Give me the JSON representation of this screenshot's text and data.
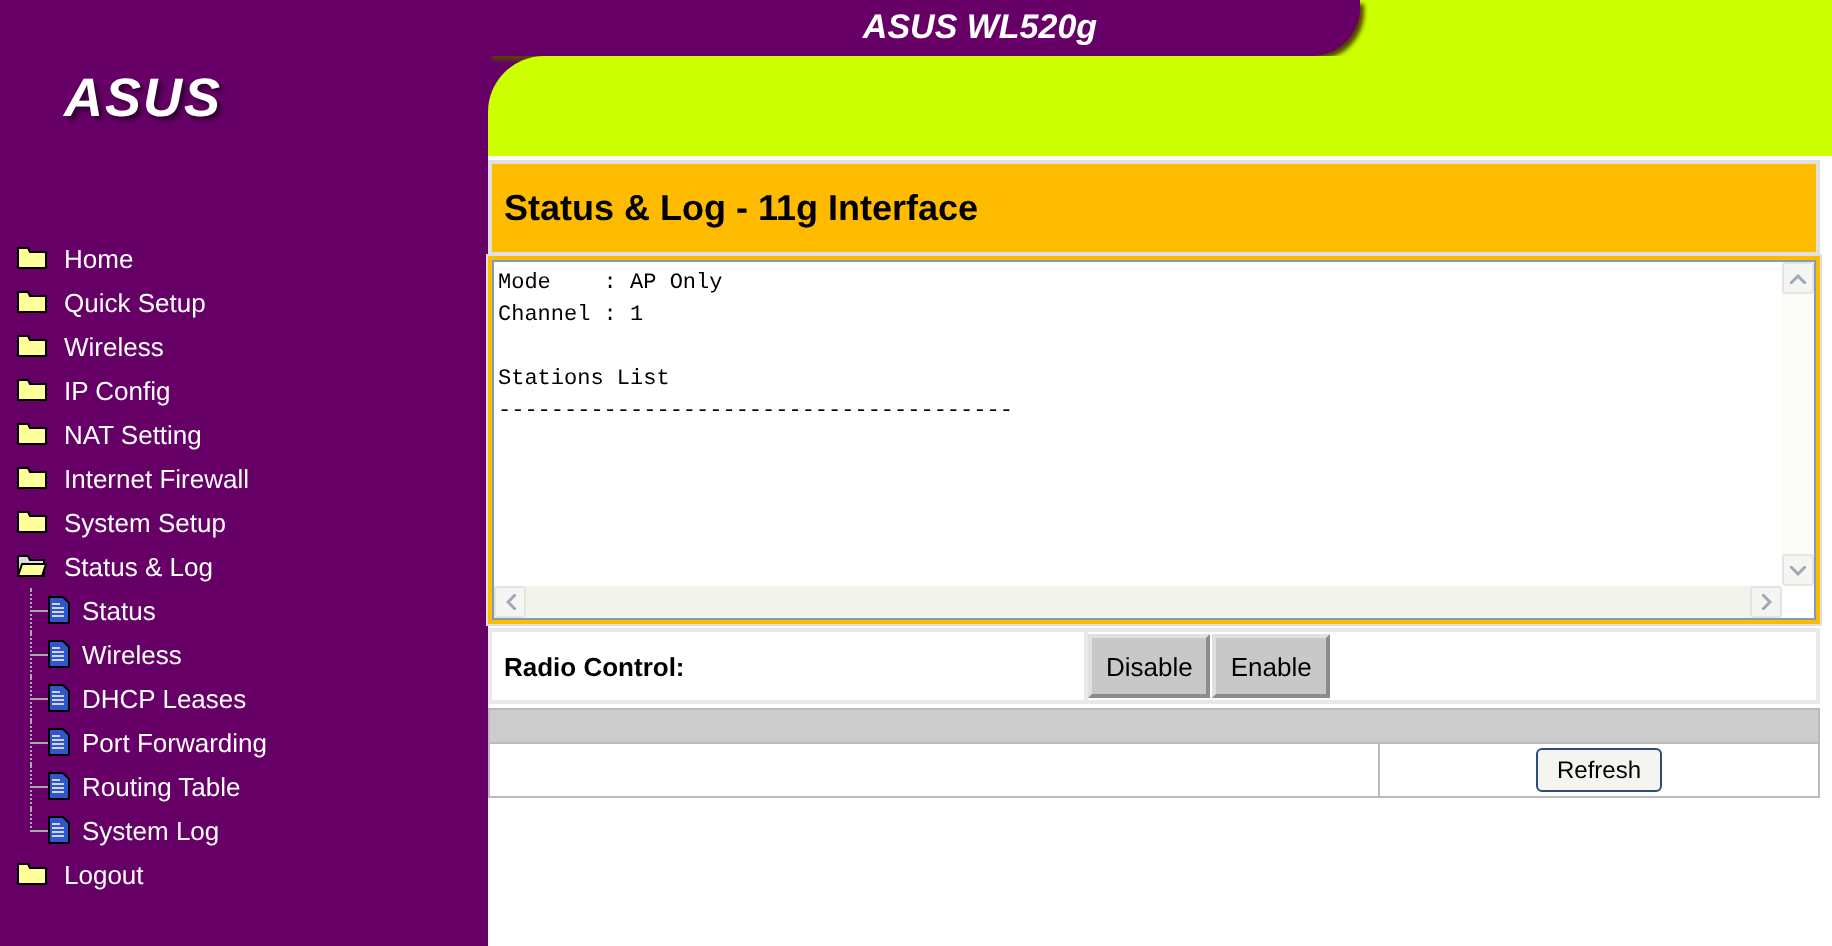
{
  "header": {
    "title": "ASUS WL520g",
    "logo": "ASUS"
  },
  "sidebar": {
    "items": [
      {
        "label": "Home",
        "expanded": false
      },
      {
        "label": "Quick Setup",
        "expanded": false
      },
      {
        "label": "Wireless",
        "expanded": false
      },
      {
        "label": "IP Config",
        "expanded": false
      },
      {
        "label": "NAT Setting",
        "expanded": false
      },
      {
        "label": "Internet Firewall",
        "expanded": false
      },
      {
        "label": "System Setup",
        "expanded": false
      },
      {
        "label": "Status & Log",
        "expanded": true,
        "children": [
          {
            "label": "Status"
          },
          {
            "label": "Wireless"
          },
          {
            "label": "DHCP Leases"
          },
          {
            "label": "Port Forwarding"
          },
          {
            "label": "Routing Table"
          },
          {
            "label": "System Log"
          }
        ]
      },
      {
        "label": "Logout",
        "expanded": false
      }
    ]
  },
  "page_title": "Status & Log - 11g Interface",
  "log_text": "Mode    : AP Only\nChannel : 1\n\nStations List\n---------------------------------------",
  "radio_control": {
    "label": "Radio Control:",
    "buttons": [
      "Disable",
      "Enable"
    ]
  },
  "refresh_button": "Refresh"
}
